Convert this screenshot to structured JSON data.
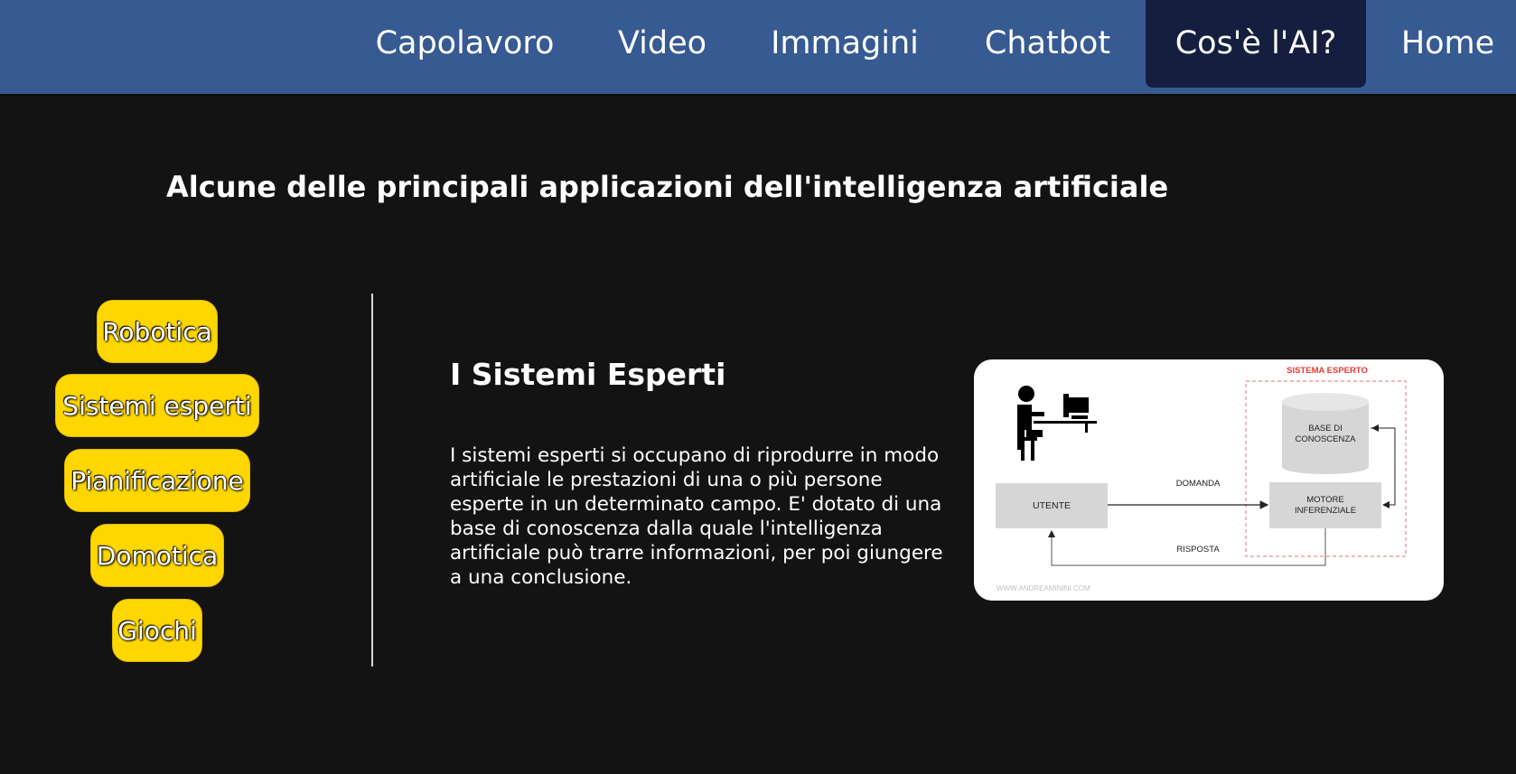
{
  "nav": {
    "items": [
      {
        "label": "Capolavoro"
      },
      {
        "label": "Video"
      },
      {
        "label": "Immagini"
      },
      {
        "label": "Chatbot"
      },
      {
        "label": "Cos'è l'AI?"
      },
      {
        "label": "Home"
      }
    ],
    "active_index": 4
  },
  "page": {
    "title": "Alcune delle principali applicazioni dell'intelligenza artificiale"
  },
  "sidebar": {
    "buttons": [
      {
        "label": "Robotica"
      },
      {
        "label": "Sistemi esperti"
      },
      {
        "label": "Pianificazione"
      },
      {
        "label": "Domotica"
      },
      {
        "label": "Giochi"
      }
    ]
  },
  "content": {
    "title": "I Sistemi Esperti",
    "text": "I sistemi esperti si occupano di riprodurre in modo artificiale le prestazioni di una o più persone esperte in un determinato campo. E' dotato di una base di conoscenza dalla quale l'intelligenza artificiale può trarre informazioni, per poi giungere a una conclusione."
  },
  "diagram": {
    "system_label": "SISTEMA ESPERTO",
    "kb_line1": "BASE DI",
    "kb_line2": "CONOSCENZA",
    "user_label": "UTENTE",
    "engine_line1": "MOTORE",
    "engine_line2": "INFERENZIALE",
    "request_label": "DOMANDA",
    "response_label": "RISPOSTA",
    "watermark": "WWW.ANDREAMININI.COM"
  },
  "colors": {
    "nav_bg": "#365a91",
    "nav_active_bg": "#151e3e",
    "page_bg": "#131313",
    "button_bg": "#ffd700",
    "system_border": "#f08a95"
  }
}
